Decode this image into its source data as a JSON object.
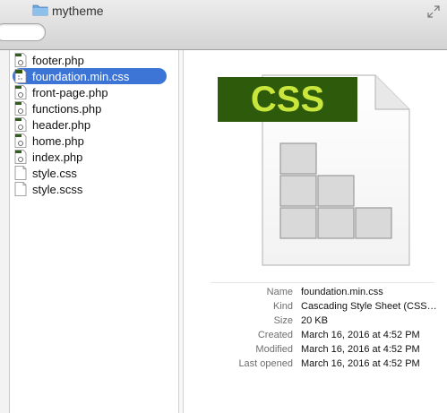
{
  "window": {
    "title": "mytheme",
    "folder_icon": "folder-icon"
  },
  "files": [
    {
      "name": "footer.php",
      "icon": "php-file-icon",
      "selected": false
    },
    {
      "name": "foundation.min.css",
      "icon": "css-file-icon",
      "selected": true
    },
    {
      "name": "front-page.php",
      "icon": "php-file-icon",
      "selected": false
    },
    {
      "name": "functions.php",
      "icon": "php-file-icon",
      "selected": false
    },
    {
      "name": "header.php",
      "icon": "php-file-icon",
      "selected": false
    },
    {
      "name": "home.php",
      "icon": "php-file-icon",
      "selected": false
    },
    {
      "name": "index.php",
      "icon": "php-file-icon",
      "selected": false
    },
    {
      "name": "style.css",
      "icon": "blank-file-icon",
      "selected": false
    },
    {
      "name": "style.scss",
      "icon": "blank-file-icon",
      "selected": false
    }
  ],
  "preview": {
    "badge": "CSS",
    "badge_color": "#2d5a0b",
    "badge_text_color": "#c8e63c",
    "info": {
      "name_label": "Name",
      "name_value": "foundation.min.css",
      "kind_label": "Kind",
      "kind_value": "Cascading Style Sheet (CSS…",
      "size_label": "Size",
      "size_value": "20 KB",
      "created_label": "Created",
      "created_value": "March 16, 2016 at 4:52 PM",
      "modified_label": "Modified",
      "modified_value": "March 16, 2016 at 4:52 PM",
      "opened_label": "Last opened",
      "opened_value": "March 16, 2016 at 4:52 PM"
    }
  },
  "colors": {
    "selection": "#3d75d6",
    "titlebar": "#dcdcdc"
  }
}
